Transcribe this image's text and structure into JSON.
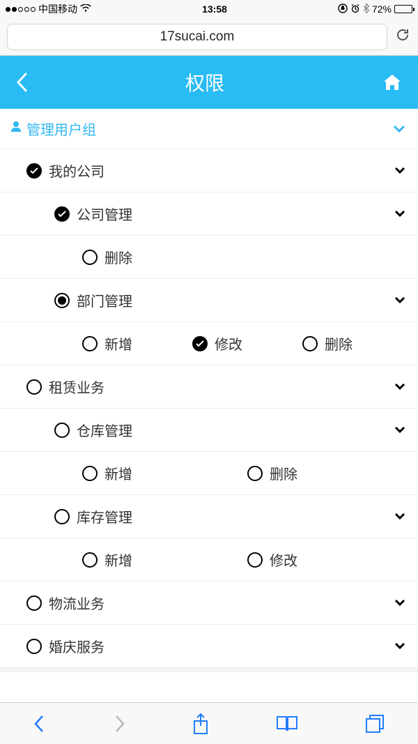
{
  "status": {
    "carrier": "中国移动",
    "time": "13:58",
    "battery": "72%"
  },
  "safari": {
    "url": "17sucai.com"
  },
  "header": {
    "title": "权限"
  },
  "group": {
    "label": "管理用户组"
  },
  "tree": {
    "my_company": "我的公司",
    "company_mgmt": "公司管理",
    "delete": "删除",
    "dept_mgmt": "部门管理",
    "add": "新增",
    "modify": "修改",
    "rental_biz": "租赁业务",
    "warehouse_mgmt": "仓库管理",
    "stock_mgmt": "库存管理",
    "logistics_biz": "物流业务",
    "wedding_service": "婚庆服务"
  }
}
